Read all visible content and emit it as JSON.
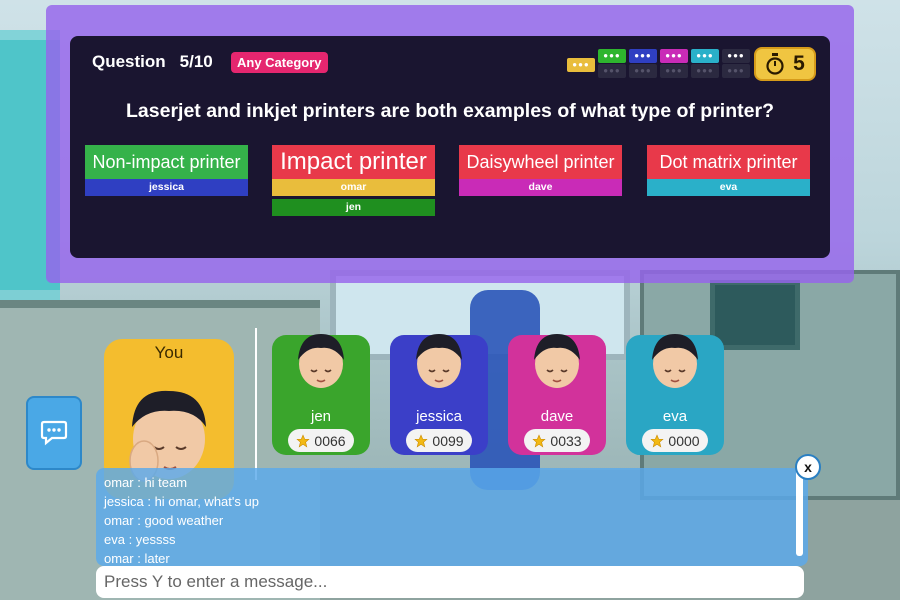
{
  "question": {
    "counter_label": "Question",
    "counter_value": "5/10",
    "category": "Any Category",
    "text": "Laserjet and inkjet printers are both examples of what type of printer?"
  },
  "answers": [
    {
      "label": "Non-impact printer",
      "color": "#35b24a",
      "voters": [
        {
          "name": "jessica",
          "color": "#2f3fc2"
        }
      ]
    },
    {
      "label": "Impact printer",
      "color": "#e8394a",
      "voters": [
        {
          "name": "omar",
          "color": "#e9bd3c"
        },
        {
          "name": "jen",
          "color": "#1f8f1f"
        }
      ]
    },
    {
      "label": "Daisywheel printer",
      "color": "#e8394a",
      "voters": [
        {
          "name": "dave",
          "color": "#c92bb7"
        }
      ]
    },
    {
      "label": "Dot matrix printer",
      "color": "#e8394a",
      "voters": [
        {
          "name": "eva",
          "color": "#2ab0c9"
        }
      ]
    }
  ],
  "progress": {
    "dots": "●●●",
    "you_color": "#e9bd3c",
    "players": [
      {
        "name": "jen",
        "color": "#2eb52e"
      },
      {
        "name": "jessica",
        "color": "#2f3fc2"
      },
      {
        "name": "dave",
        "color": "#c92bb7"
      },
      {
        "name": "eva",
        "color": "#2ab0c9"
      },
      {
        "name": "empty",
        "color": "#2b2940"
      }
    ]
  },
  "timer": {
    "value": "5",
    "icon": "stopwatch-icon"
  },
  "you": {
    "label": "You",
    "color": "#f4bd2e"
  },
  "players": [
    {
      "name": "jen",
      "score": "0066",
      "color": "#3aa52c"
    },
    {
      "name": "jessica",
      "score": "0099",
      "color": "#3b3fc8"
    },
    {
      "name": "dave",
      "score": "0033",
      "color": "#d2329b"
    },
    {
      "name": "eva",
      "score": "0000",
      "color": "#2aa6c4"
    }
  ],
  "chat": {
    "toggle_icon": "chat-bubble-icon",
    "close_label": "x",
    "messages": [
      "omar : hi team",
      "jessica : hi omar, what's up",
      "omar : good weather",
      "eva : yessss",
      "omar : later"
    ],
    "placeholder": "Press Y to enter a message..."
  }
}
